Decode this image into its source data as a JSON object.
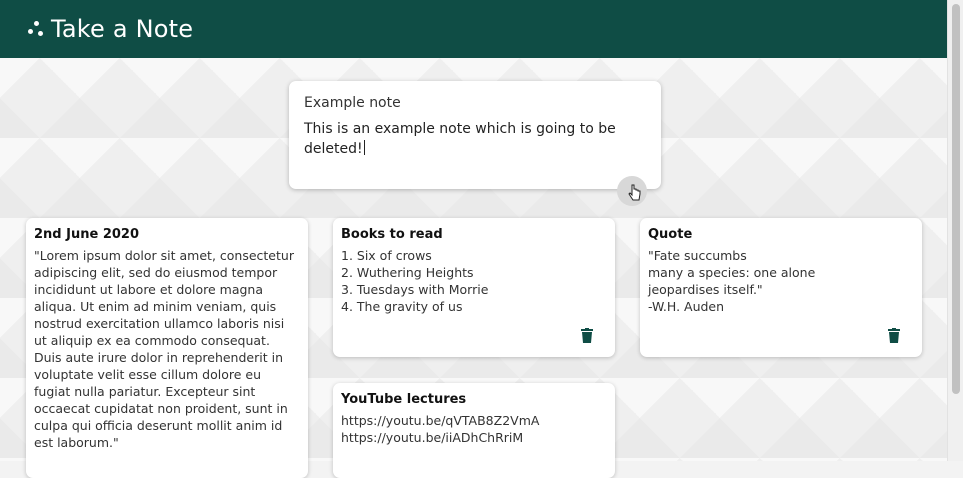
{
  "header": {
    "title": "Take a Note",
    "icon": "dots-icon",
    "bg_color": "#0f4d45"
  },
  "create": {
    "title": "Example note",
    "content": "This is an example note which is going to be deleted!",
    "add_icon": "plus-icon"
  },
  "notes": [
    {
      "title": "2nd June 2020",
      "content": "\"Lorem ipsum dolor sit amet, consectetur adipiscing elit, sed do eiusmod tempor incididunt ut labore et dolore magna aliqua. Ut enim ad minim veniam, quis nostrud exercitation ullamco laboris nisi ut aliquip ex ea commodo consequat. Duis aute irure dolor in reprehenderit in voluptate velit esse cillum dolore eu fugiat nulla pariatur. Excepteur sint occaecat cupidatat non proident, sunt in culpa qui officia deserunt mollit anim id est laborum.\""
    },
    {
      "title": "Books to read",
      "content": "1.  Six of crows\n2. Wuthering Heights\n3. Tuesdays with Morrie\n4. The gravity of us"
    },
    {
      "title": "Quote",
      "content": "\"Fate succumbs\nmany a species: one alone\njeopardises itself.\"\n-W.H. Auden"
    },
    {
      "title": "YouTube lectures",
      "content": "https://youtu.be/qVTAB8Z2VmA\nhttps://youtu.be/iiADhChRriM"
    }
  ],
  "delete_icon": "trash-icon",
  "accent_color": "#0f4d45"
}
